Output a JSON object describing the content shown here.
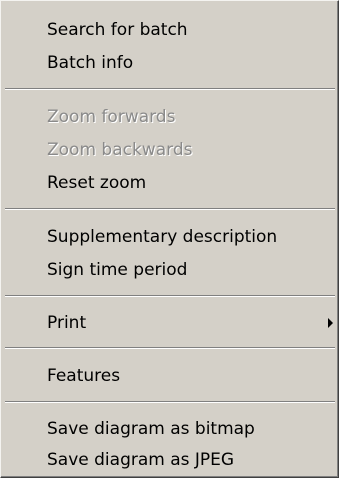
{
  "menu": {
    "items": [
      {
        "label": "Search for batch",
        "enabled": true
      },
      {
        "label": "Batch info",
        "enabled": true
      },
      {
        "label": "Zoom forwards",
        "enabled": false
      },
      {
        "label": "Zoom backwards",
        "enabled": false
      },
      {
        "label": "Reset zoom",
        "enabled": true
      },
      {
        "label": "Supplementary description",
        "enabled": true
      },
      {
        "label": "Sign time period",
        "enabled": true
      },
      {
        "label": "Print",
        "enabled": true,
        "submenu": true,
        "icon": "chevron-right-icon"
      },
      {
        "label": "Features",
        "enabled": true
      },
      {
        "label": "Save diagram as bitmap",
        "enabled": true
      },
      {
        "label": "Save diagram as JPEG",
        "enabled": true
      }
    ]
  },
  "colors": {
    "background": "#d4d0c8",
    "text": "#000000",
    "disabled_text": "#8a8a8a"
  }
}
